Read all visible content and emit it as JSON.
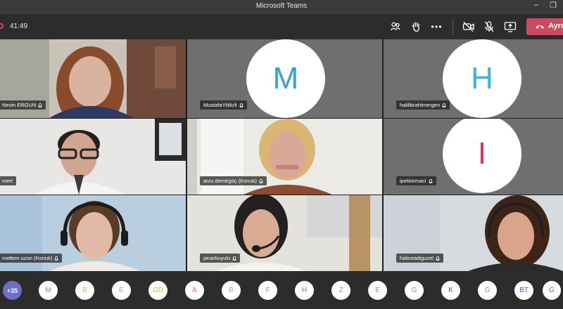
{
  "window": {
    "title": "Microsoft Teams"
  },
  "toolbar": {
    "timer": "41:49",
    "leave_label": "Ayrıl",
    "icons": [
      "participants-icon",
      "raise-hand-icon",
      "more-options-icon",
      "camera-off-icon",
      "mic-off-icon",
      "share-screen-icon",
      "hang-up-icon"
    ]
  },
  "participants": [
    {
      "name": "Nevin ERGUN",
      "video": true
    },
    {
      "name": "MustafaYildizli",
      "initial": "M",
      "initial_color": "#3a9fd6"
    },
    {
      "name": "halilibrahimergen",
      "initial": "H",
      "initial_color": "#3ab6d8"
    },
    {
      "name": "mert",
      "video": true
    },
    {
      "name": "arzu demirgöç (Konuk)",
      "video": true
    },
    {
      "name": "ipekkirmaci",
      "initial": "I",
      "initial_color": "#e0356a"
    },
    {
      "name": "meltem uzun (Konuk)",
      "video": true
    },
    {
      "name": "pinarkuyulu",
      "video": true
    },
    {
      "name": "haticeadiguzel",
      "video": true
    }
  ],
  "roster": {
    "overflow_count": "+35",
    "avatars": [
      {
        "initial": "M",
        "color": "#7c8bd6"
      },
      {
        "initial": "B",
        "color": "#e9b43a"
      },
      {
        "initial": "E",
        "color": "#8fbf7a"
      },
      {
        "initial": "GD",
        "color": "#e8b040"
      },
      {
        "initial": "A",
        "color": "#e8656a"
      },
      {
        "initial": "B",
        "color": "#e58a8c"
      },
      {
        "initial": "F",
        "color": "#7ab65c"
      },
      {
        "initial": "H",
        "color": "#3a96d0"
      },
      {
        "initial": "Z",
        "color": "#9b8fc9"
      },
      {
        "initial": "E",
        "color": "#e07a85"
      },
      {
        "initial": "G",
        "color": "#56b7a8"
      },
      {
        "initial": "K",
        "color": "#3d5aa8"
      },
      {
        "initial": "G",
        "color": "#5bb0a3"
      },
      {
        "initial": "BT",
        "color": "#4a5ea0"
      },
      {
        "initial": "G",
        "color": "#cc4a5f"
      }
    ]
  }
}
